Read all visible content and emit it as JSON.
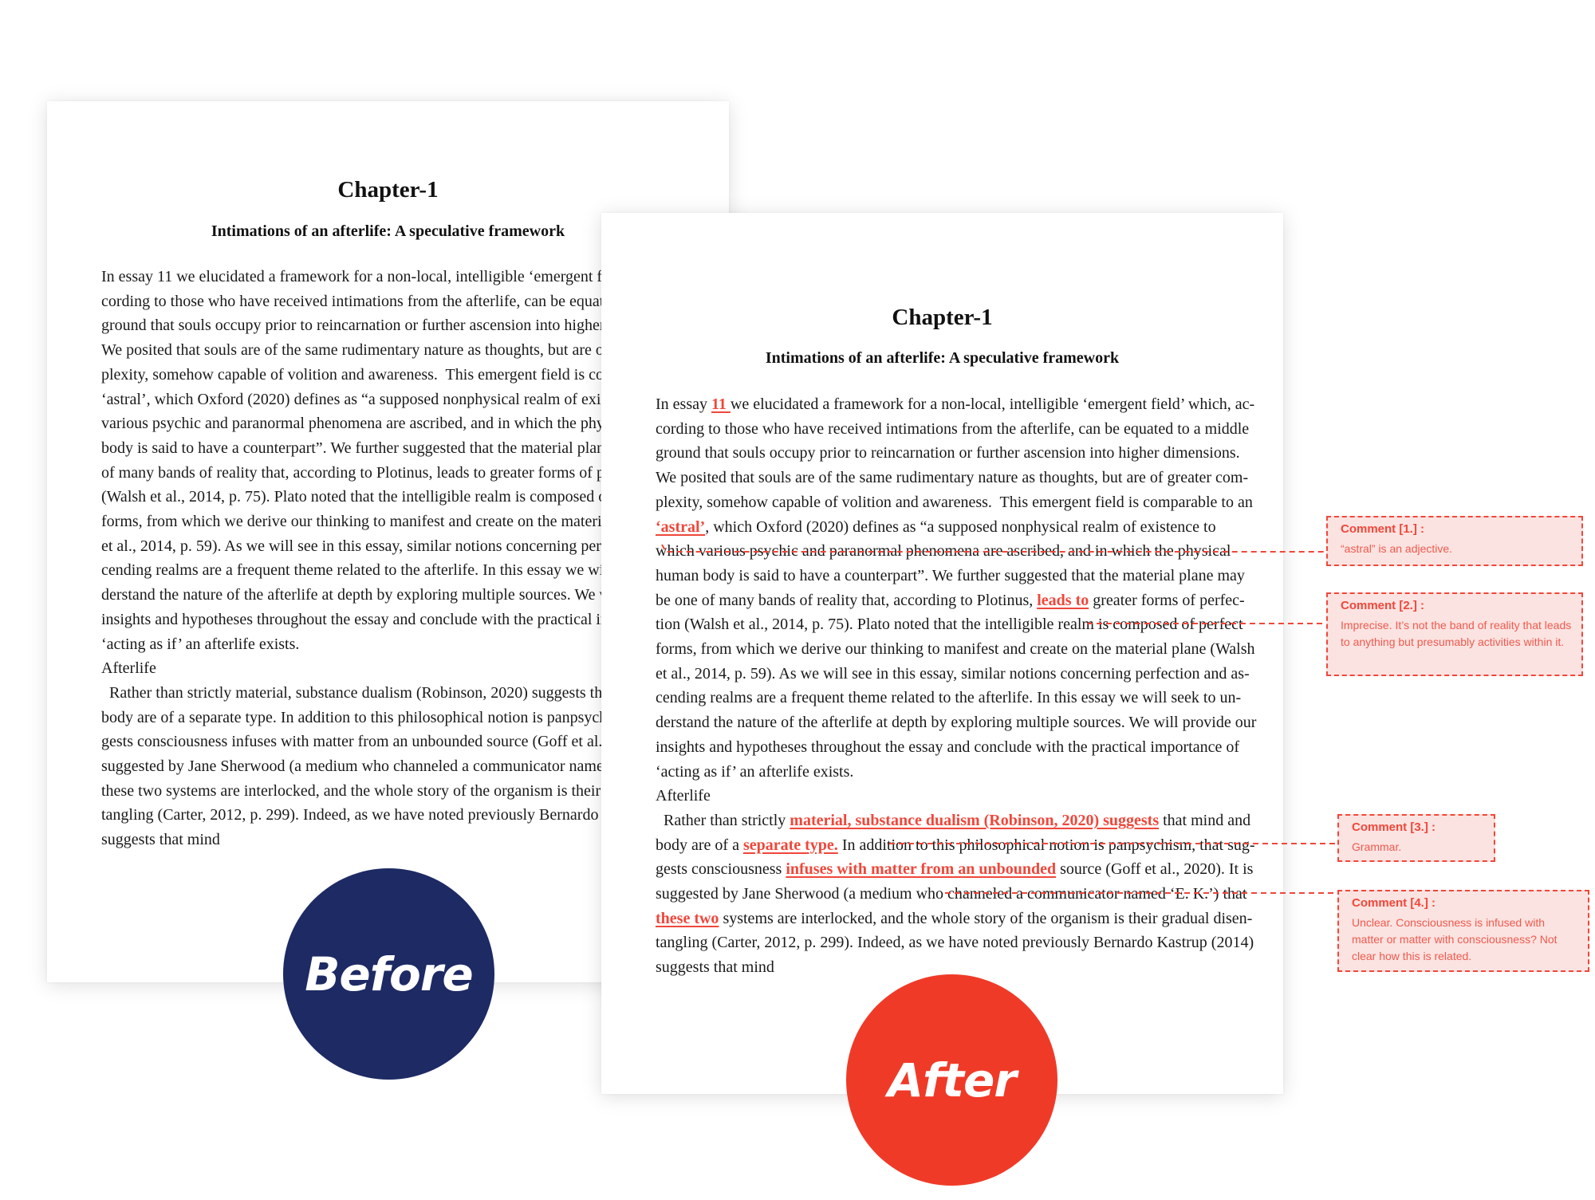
{
  "before": {
    "badge_label": "Before",
    "title": "Chapter-1",
    "subtitle": "Intimations of an afterlife: A speculative framework",
    "lines": [
      "In essay 11 we elucidated a framework for a non-local, intelligible ‘emergent field’ which, ac-",
      "cording to those who have received intimations from the afterlife, can be equated to a middle",
      "ground that souls occupy prior to reincarnation or further ascension into higher dimensions.",
      "We posited that souls are of the same rudimentary nature as thoughts, but are of greater com-",
      "plexity, somehow capable of volition and awareness.  This emergent field is comparable to an",
      "‘astral’, which Oxford (2020) defines as “a supposed nonphysical realm of existence to which",
      "various psychic and paranormal phenomena are ascribed, and in which the physical human",
      "body is said to have a counterpart”. We further suggested that the material plane may be one",
      "of many bands of reality that, according to Plotinus, leads to greater forms of perfection",
      "(Walsh et al., 2014, p. 75). Plato noted that the intelligible realm is composed of perfect",
      "forms, from which we derive our thinking to manifest and create on the material plane (Walsh",
      "et al., 2014, p. 59). As we will see in this essay, similar notions concerning perfection and as-",
      "cending realms are a frequent theme related to the afterlife. In this essay we will seek to un-",
      "derstand the nature of the afterlife at depth by exploring multiple sources. We will provide our",
      "insights and hypotheses throughout the essay and conclude with the practical importance of",
      "‘acting as if’ an afterlife exists.",
      "Afterlife",
      "  Rather than strictly material, substance dualism (Robinson, 2020) suggests that mind and",
      "body are of a separate type. In addition to this philosophical notion is panpsychism, that sug-",
      "gests consciousness infuses with matter from an unbounded source (Goff et al., 2020). It is",
      "suggested by Jane Sherwood (a medium who channeled a communicator named ‘E. K.’) that",
      "these two systems are interlocked, and the whole story of the organism is their gradual disen-",
      "tangling (Carter, 2012, p. 299). Indeed, as we have noted previously Bernardo Kastrup (2014)",
      "suggests that mind"
    ]
  },
  "after": {
    "badge_label": "After",
    "title": "Chapter-1",
    "subtitle": "Intimations of an afterlife: A speculative framework",
    "lines": [
      [
        {
          "t": "In essay "
        },
        {
          "t": "11 ",
          "h": true
        },
        {
          "t": "we elucidated a framework for a non-local, intelligible ‘emergent field’ which, ac-"
        }
      ],
      [
        {
          "t": "cording to those who have received intimations from the afterlife, can be equated to a middle"
        }
      ],
      [
        {
          "t": "ground that souls occupy prior to reincarnation or further ascension into higher dimensions."
        }
      ],
      [
        {
          "t": "We posited that souls are of the same rudimentary nature as thoughts, but are of greater com-"
        }
      ],
      [
        {
          "t": "plexity, somehow capable of volition and awareness.  This emergent field is comparable to an"
        }
      ],
      [
        {
          "t": "‘astral’",
          "h": true
        },
        {
          "t": ", which Oxford (2020) defines as “a supposed nonphysical realm of existence to"
        }
      ],
      [
        {
          "t": "which various psychic and paranormal phenomena are ascribed, and in which the physical"
        }
      ],
      [
        {
          "t": "human body is said to have a counterpart”. We further suggested that the material plane may"
        }
      ],
      [
        {
          "t": "be one of many bands of reality that, according to Plotinus, "
        },
        {
          "t": "leads to",
          "h": true
        },
        {
          "t": " greater forms of perfec-"
        }
      ],
      [
        {
          "t": "tion (Walsh et al., 2014, p. 75). Plato noted that the intelligible realm is composed of perfect"
        }
      ],
      [
        {
          "t": "forms, from which we derive our thinking to manifest and create on the material plane (Walsh"
        }
      ],
      [
        {
          "t": "et al., 2014, p. 59). As we will see in this essay, similar notions concerning perfection and as-"
        }
      ],
      [
        {
          "t": "cending realms are a frequent theme related to the afterlife. In this essay we will seek to un-"
        }
      ],
      [
        {
          "t": "derstand the nature of the afterlife at depth by exploring multiple sources. We will provide our"
        }
      ],
      [
        {
          "t": "insights and hypotheses throughout the essay and conclude with the practical importance of"
        }
      ],
      [
        {
          "t": "‘acting as if’ an afterlife exists."
        }
      ],
      [
        {
          "t": "Afterlife"
        }
      ],
      [
        {
          "t": "  Rather than strictly "
        },
        {
          "t": "material, substance dualism (Robinson, 2020) suggests",
          "h": true
        },
        {
          "t": " that mind and"
        }
      ],
      [
        {
          "t": "body are of a "
        },
        {
          "t": "separate type.",
          "h": true
        },
        {
          "t": " In addition to this philosophical notion is panpsychism, that sug-"
        }
      ],
      [
        {
          "t": "gests consciousness "
        },
        {
          "t": "infuses with matter from an unbounded",
          "h": true
        },
        {
          "t": " source (Goff et al., 2020). It is"
        }
      ],
      [
        {
          "t": "suggested by Jane Sherwood (a medium who channeled a communicator named ‘E. K.’) that"
        }
      ],
      [
        {
          "t": "these two",
          "h": true
        },
        {
          "t": " systems are interlocked, and the whole story of the organism is their gradual disen-"
        }
      ],
      [
        {
          "t": "tangling (Carter, 2012, p. 299). Indeed, as we have noted previously Bernardo Kastrup (2014)"
        }
      ],
      [
        {
          "t": "suggests that mind"
        }
      ]
    ]
  },
  "comments": [
    {
      "title": "Comment [1.] :",
      "text": "“astral” is an adjective."
    },
    {
      "title": "Comment [2.] :",
      "text": "Imprecise. It’s not the band of reality that leads to anything but presumably activities within it."
    },
    {
      "title": "Comment [3.] :",
      "text": "Grammar."
    },
    {
      "title": "Comment [4.] :",
      "text": "Unclear. Consciousness is infused with matter or matter with consciousness? Not clear how this is related."
    }
  ],
  "colors": {
    "before_badge": "#1d2a64",
    "after_badge": "#f03a28",
    "highlight": "#f0473a",
    "comment_bg": "#fbe3e1"
  }
}
